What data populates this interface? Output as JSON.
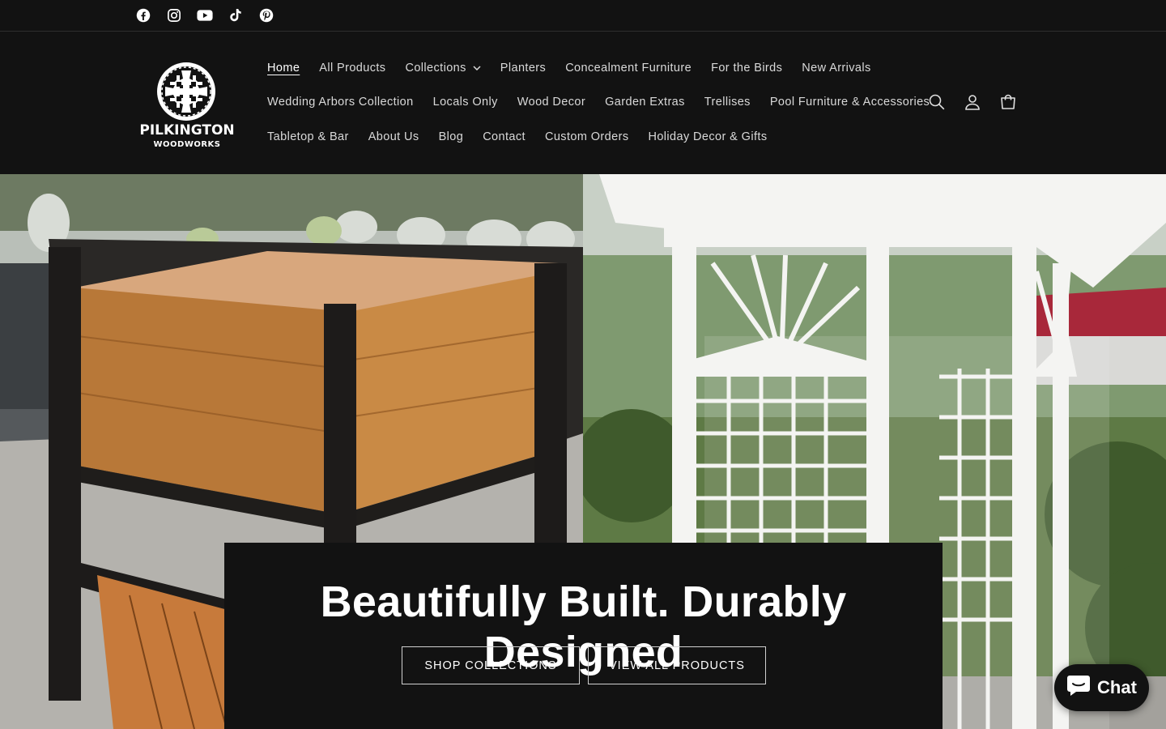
{
  "social": [
    {
      "name": "facebook-icon"
    },
    {
      "name": "instagram-icon"
    },
    {
      "name": "youtube-icon"
    },
    {
      "name": "tiktok-icon"
    },
    {
      "name": "pinterest-icon"
    }
  ],
  "brand": {
    "line1": "PILKINGTON",
    "line2": "WOODWORKS"
  },
  "nav": {
    "row1": [
      "Home",
      "All Products",
      "Collections",
      "Planters",
      "Concealment Furniture",
      "For the Birds",
      "New Arrivals"
    ],
    "row2": [
      "Wedding Arbors Collection",
      "Locals Only",
      "Wood Decor",
      "Garden Extras",
      "Trellises",
      "Pool Furniture & Accessories"
    ],
    "row3": [
      "Tabletop & Bar",
      "About Us",
      "Blog",
      "Contact",
      "Custom Orders",
      "Holiday Decor & Gifts"
    ],
    "active": "Home",
    "dropdown": "Collections"
  },
  "header_icons": [
    "search-icon",
    "account-icon",
    "cart-icon"
  ],
  "hero": {
    "title": "Beautifully Built. Durably Designed",
    "button1": "SHOP COLLECTIONS",
    "button2": "VIEW ALL PRODUCTS"
  },
  "chat": {
    "label": "Chat"
  },
  "colors": {
    "background": "#121212",
    "text": "#ffffff",
    "nav_text": "#d9d9d9"
  }
}
